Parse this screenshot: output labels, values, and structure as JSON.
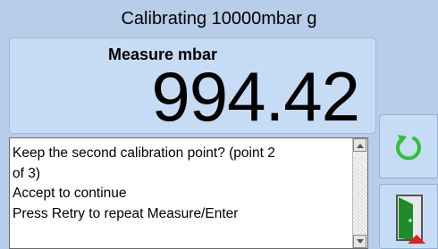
{
  "header": {
    "title": "Calibrating 10000mbar g"
  },
  "measurement": {
    "label": "Measure mbar",
    "value": "994.42"
  },
  "message": {
    "lines": [
      "Keep the second calibration point? (point 2",
      "of 3)",
      "Accept to continue",
      "Press Retry to repeat Measure/Enter"
    ]
  },
  "buttons": {
    "retry_icon": "refresh-icon",
    "accept_icon": "exit-door-icon"
  },
  "colors": {
    "background": "#b7cde9",
    "panel": "#c6dcf4",
    "retry_green": "#2fbf3a",
    "door_green": "#1f8a2a",
    "accent_red": "#e02020"
  }
}
